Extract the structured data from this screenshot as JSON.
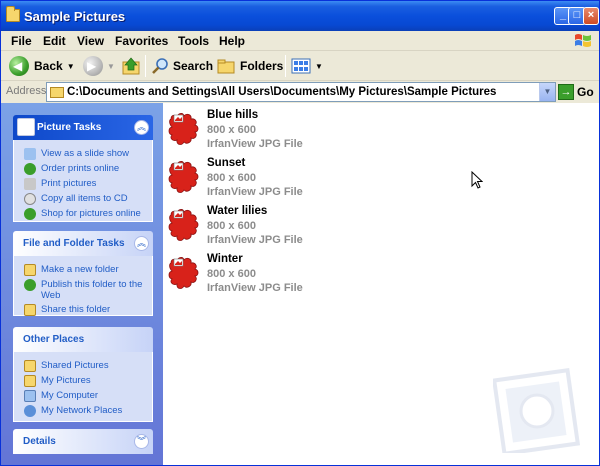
{
  "window": {
    "title": "Sample Pictures"
  },
  "menu": [
    "File",
    "Edit",
    "View",
    "Favorites",
    "Tools",
    "Help"
  ],
  "toolbar": {
    "back": "Back",
    "search": "Search",
    "folders": "Folders"
  },
  "address": {
    "label": "Address",
    "path": "C:\\Documents and Settings\\All Users\\Documents\\My Pictures\\Sample Pictures",
    "go": "Go"
  },
  "sidebar": {
    "picture_tasks": {
      "title": "Picture Tasks",
      "items": [
        "View as a slide show",
        "Order prints online",
        "Print pictures",
        "Copy all items to CD",
        "Shop for pictures online"
      ]
    },
    "file_folder_tasks": {
      "title": "File and Folder Tasks",
      "items": [
        "Make a new folder",
        "Publish this folder to the Web",
        "Share this folder"
      ]
    },
    "other_places": {
      "title": "Other Places",
      "items": [
        "Shared Pictures",
        "My Pictures",
        "My Computer",
        "My Network Places"
      ]
    },
    "details": {
      "title": "Details"
    }
  },
  "files": [
    {
      "name": "Blue hills",
      "size": "800 x 600",
      "type": "IrfanView JPG File"
    },
    {
      "name": "Sunset",
      "size": "800 x 600",
      "type": "IrfanView JPG File"
    },
    {
      "name": "Water lilies",
      "size": "800 x 600",
      "type": "IrfanView JPG File"
    },
    {
      "name": "Winter",
      "size": "800 x 600",
      "type": "IrfanView JPG File"
    }
  ],
  "colors": {
    "titlebar": "#0a4fdc",
    "sidebar": "#6f8ede",
    "link": "#215dc6",
    "file_icon": "#d8221a"
  }
}
